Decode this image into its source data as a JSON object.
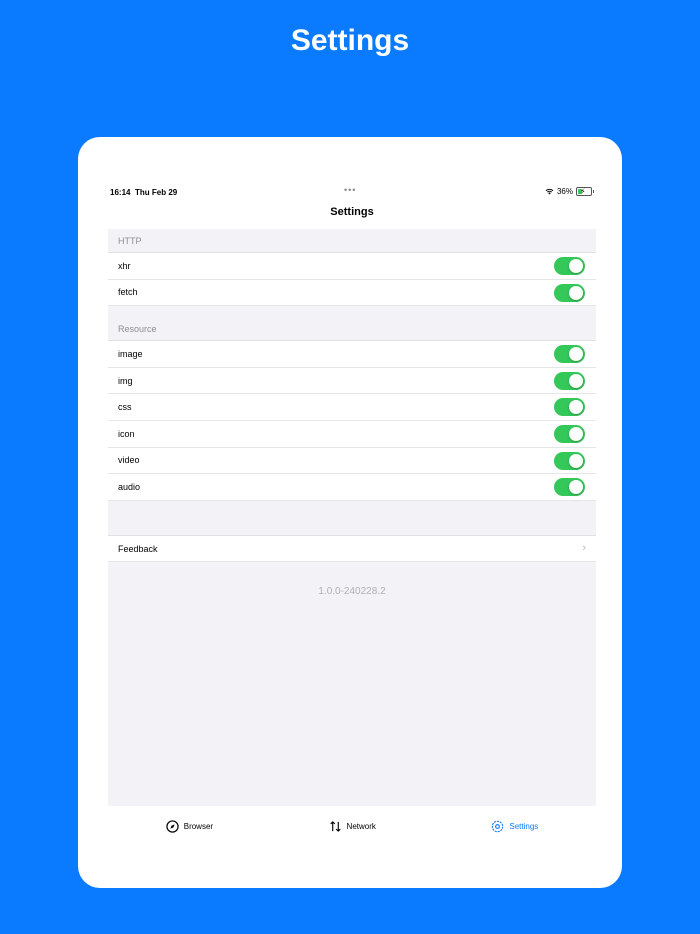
{
  "page_title": "Settings",
  "status_bar": {
    "time": "16:14",
    "date": "Thu Feb 29",
    "battery": "36%",
    "more_dots": "•••"
  },
  "nav": {
    "title": "Settings"
  },
  "sections": {
    "http": {
      "header": "HTTP",
      "items": [
        "xhr",
        "fetch"
      ]
    },
    "resource": {
      "header": "Resource",
      "items": [
        "image",
        "img",
        "css",
        "icon",
        "video",
        "audio"
      ]
    }
  },
  "toggles_all_on": true,
  "feedback": {
    "label": "Feedback"
  },
  "version": "1.0.0-240228.2",
  "tabbar": {
    "browser": "Browser",
    "network": "Network",
    "settings": "Settings"
  },
  "colors": {
    "background": "#0a7bff",
    "toggle_on": "#34c759",
    "accent": "#0a7bff"
  }
}
